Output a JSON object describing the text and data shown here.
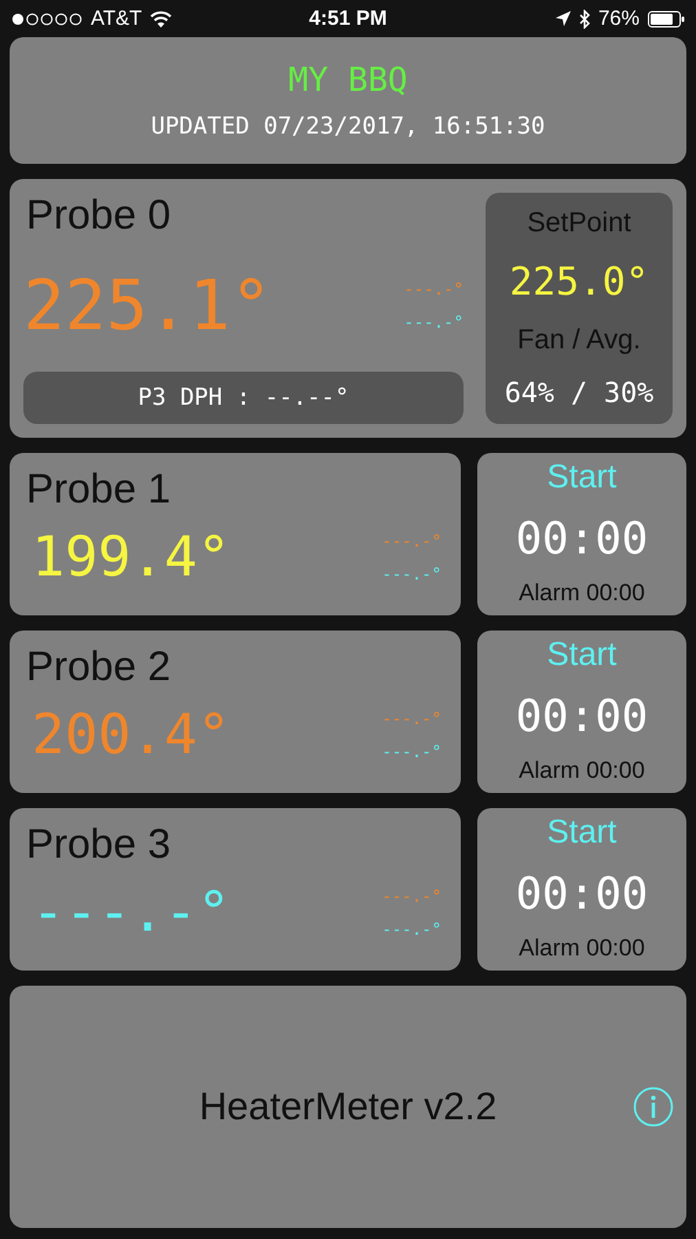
{
  "status_bar": {
    "carrier": "AT&T",
    "time": "4:51 PM",
    "battery": "76%"
  },
  "header": {
    "title": "MY BBQ",
    "updated": "UPDATED 07/23/2017, 16:51:30"
  },
  "pit": {
    "name": "Probe 0",
    "temperature": "225.1°",
    "color": "#f0862c",
    "alarm_high": "---.-°",
    "alarm_low": "---.-°",
    "dph": "P3 DPH : --.--°",
    "setpoint_label": "SetPoint",
    "setpoint": "225.0°",
    "fan_label": "Fan / Avg.",
    "fan": "64% / 30%"
  },
  "probes": [
    {
      "name": "Probe 1",
      "temperature": "199.4°",
      "color": "#f5f542",
      "alarm_high": "---.-°",
      "alarm_low": "---.-°",
      "timer_button": "Start",
      "timer": "00:00",
      "alarm": "Alarm 00:00"
    },
    {
      "name": "Probe 2",
      "temperature": "200.4°",
      "color": "#f0862c",
      "alarm_high": "---.-°",
      "alarm_low": "---.-°",
      "timer_button": "Start",
      "timer": "00:00",
      "alarm": "Alarm 00:00"
    },
    {
      "name": "Probe 3",
      "temperature": "---.-°",
      "color": "#5ef0f0",
      "alarm_high": "---.-°",
      "alarm_low": "---.-°",
      "timer_button": "Start",
      "timer": "00:00",
      "alarm": "Alarm 00:00"
    }
  ],
  "footer": {
    "version": "HeaterMeter v2.2"
  }
}
